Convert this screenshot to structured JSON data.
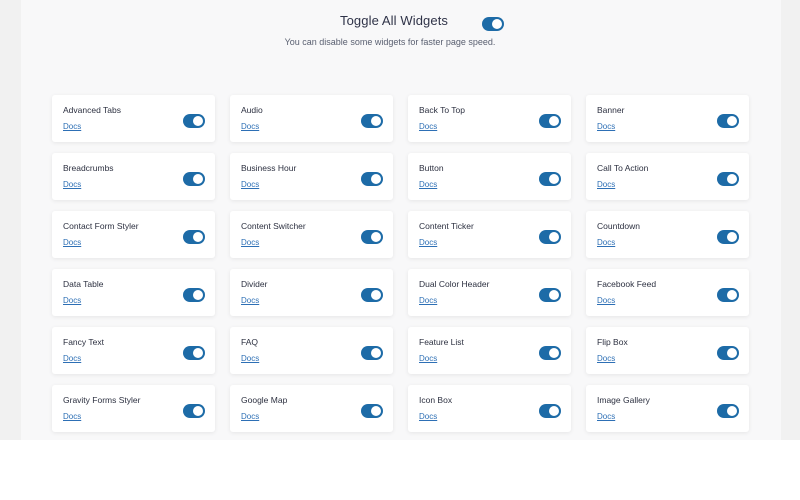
{
  "header": {
    "title": "Toggle All Widgets",
    "subtitle": "You can disable some widgets for faster page speed.",
    "toggle_all_on": true
  },
  "colors": {
    "accent": "#1d6ba7",
    "link": "#2d6fb5",
    "panel_bg": "#f8f8f9",
    "card_bg": "#ffffff"
  },
  "widgets": [
    {
      "name": "Advanced Tabs",
      "docs": "Docs",
      "enabled": true
    },
    {
      "name": "Audio",
      "docs": "Docs",
      "enabled": true
    },
    {
      "name": "Back To Top",
      "docs": "Docs",
      "enabled": true
    },
    {
      "name": "Banner",
      "docs": "Docs",
      "enabled": true
    },
    {
      "name": "Breadcrumbs",
      "docs": "Docs",
      "enabled": true
    },
    {
      "name": "Business Hour",
      "docs": "Docs",
      "enabled": true
    },
    {
      "name": "Button",
      "docs": "Docs",
      "enabled": true
    },
    {
      "name": "Call To Action",
      "docs": "Docs",
      "enabled": true
    },
    {
      "name": "Contact Form Styler",
      "docs": "Docs",
      "enabled": true
    },
    {
      "name": "Content Switcher",
      "docs": "Docs",
      "enabled": true
    },
    {
      "name": "Content Ticker",
      "docs": "Docs",
      "enabled": true
    },
    {
      "name": "Countdown",
      "docs": "Docs",
      "enabled": true
    },
    {
      "name": "Data Table",
      "docs": "Docs",
      "enabled": true
    },
    {
      "name": "Divider",
      "docs": "Docs",
      "enabled": true
    },
    {
      "name": "Dual Color Header",
      "docs": "Docs",
      "enabled": true
    },
    {
      "name": "Facebook Feed",
      "docs": "Docs",
      "enabled": true
    },
    {
      "name": "Fancy Text",
      "docs": "Docs",
      "enabled": true
    },
    {
      "name": "FAQ",
      "docs": "Docs",
      "enabled": true
    },
    {
      "name": "Feature List",
      "docs": "Docs",
      "enabled": true
    },
    {
      "name": "Flip Box",
      "docs": "Docs",
      "enabled": true
    },
    {
      "name": "Gravity Forms Styler",
      "docs": "Docs",
      "enabled": true
    },
    {
      "name": "Google Map",
      "docs": "Docs",
      "enabled": true
    },
    {
      "name": "Icon Box",
      "docs": "Docs",
      "enabled": true
    },
    {
      "name": "Image Gallery",
      "docs": "Docs",
      "enabled": true
    }
  ]
}
